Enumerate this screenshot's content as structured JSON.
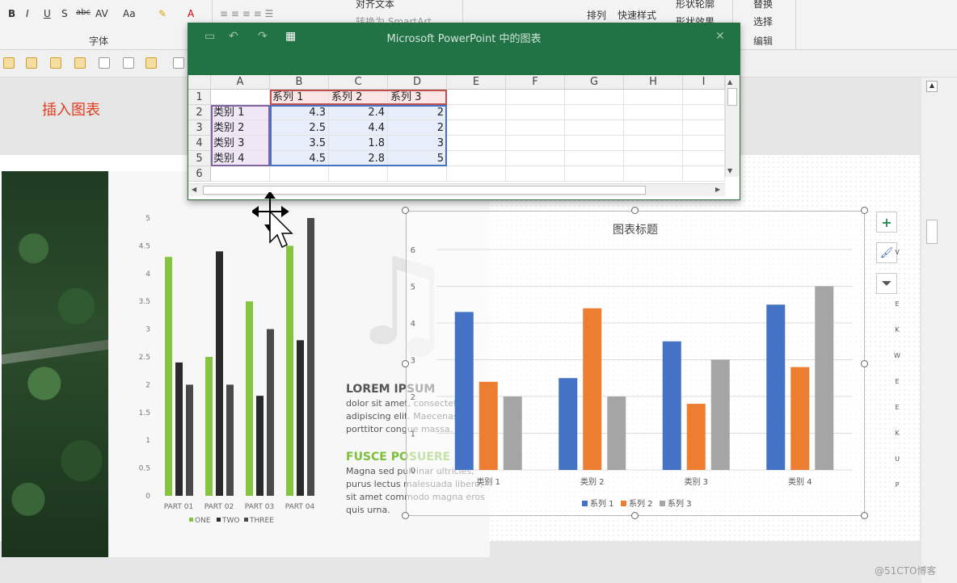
{
  "ribbon": {
    "format_buttons": [
      "B",
      "I",
      "U",
      "S",
      "abc",
      "AV",
      "Aa",
      "A"
    ],
    "font_group_label": "字体",
    "align_text_label": "对齐文本",
    "smartart_label": "转换为 SmartArt",
    "arrange_label": "排列",
    "quick_styles_label": "快速样式",
    "shape_outline_label": "形状轮廓",
    "shape_effects_label": "形状效果",
    "replace_label": "替换",
    "select_label": "选择",
    "edit_group_label": "编辑"
  },
  "slide_note": "插入图表",
  "excel": {
    "title": "Microsoft PowerPoint 中的图表",
    "columns": [
      "A",
      "B",
      "C",
      "D",
      "E",
      "F",
      "G",
      "H",
      "I"
    ],
    "rows": [
      "1",
      "2",
      "3",
      "4",
      "5",
      "6"
    ],
    "header_row": [
      "",
      "系列 1",
      "系列 2",
      "系列 3"
    ],
    "data_rows": [
      [
        "类别 1",
        "4.3",
        "2.4",
        "2"
      ],
      [
        "类别 2",
        "2.5",
        "4.4",
        "2"
      ],
      [
        "类别 3",
        "3.5",
        "1.8",
        "3"
      ],
      [
        "类别 4",
        "4.5",
        "2.8",
        "5"
      ]
    ]
  },
  "left_text": {
    "heading1": "LOREM IPSUM",
    "para1": "dolor sit amet, consectetuer adipiscing elit. Maecenas porttitor congue massa.",
    "heading2": "FUSCE POSUERE",
    "para2": "Magna sed pulvinar ultricies, purus lectus malesuada libero, sit amet commodo magna eros quis urna."
  },
  "colors": {
    "green": "#86c440",
    "black": "#2a2a2a",
    "gray_dark": "#4a4a4a",
    "blue": "#4472c4",
    "orange": "#ed7d31",
    "gray": "#a5a5a5",
    "excel_green": "#217346"
  },
  "side_buttons": [
    {
      "name": "add-chart-element-icon",
      "glyph": "+"
    },
    {
      "name": "chart-styles-brush-icon",
      "glyph": "🖌"
    },
    {
      "name": "chart-filter-icon",
      "glyph": "⏷"
    }
  ],
  "side_letters": [
    "V",
    "E",
    "K",
    "W",
    "E",
    "E",
    "K",
    "U",
    "P"
  ],
  "watermark": "@51CTO博客",
  "chart_data": [
    {
      "type": "bar",
      "title": "",
      "categories": [
        "PART 01",
        "PART 02",
        "PART 03",
        "PART 04"
      ],
      "series": [
        {
          "name": "ONE",
          "values": [
            4.3,
            2.5,
            3.5,
            4.5
          ]
        },
        {
          "name": "TWO",
          "values": [
            2.4,
            4.4,
            1.8,
            2.8
          ]
        },
        {
          "name": "THREE",
          "values": [
            2,
            2,
            3,
            5
          ]
        }
      ],
      "ylim": [
        0,
        5
      ],
      "yticks": [
        "0",
        "0.5",
        "1",
        "1.5",
        "2",
        "2.5",
        "3",
        "3.5",
        "4",
        "4.5",
        "5"
      ],
      "legend": "bottom"
    },
    {
      "type": "bar",
      "title": "图表标题",
      "categories": [
        "类别 1",
        "类别 2",
        "类别 3",
        "类别 4"
      ],
      "series": [
        {
          "name": "系列 1",
          "values": [
            4.3,
            2.5,
            3.5,
            4.5
          ]
        },
        {
          "name": "系列 2",
          "values": [
            2.4,
            4.4,
            1.8,
            2.8
          ]
        },
        {
          "name": "系列 3",
          "values": [
            2,
            2,
            3,
            5
          ]
        }
      ],
      "ylim": [
        0,
        6
      ],
      "yticks": [
        "0",
        "1",
        "2",
        "3",
        "4",
        "5",
        "6"
      ],
      "legend": "bottom",
      "grid": true
    }
  ]
}
